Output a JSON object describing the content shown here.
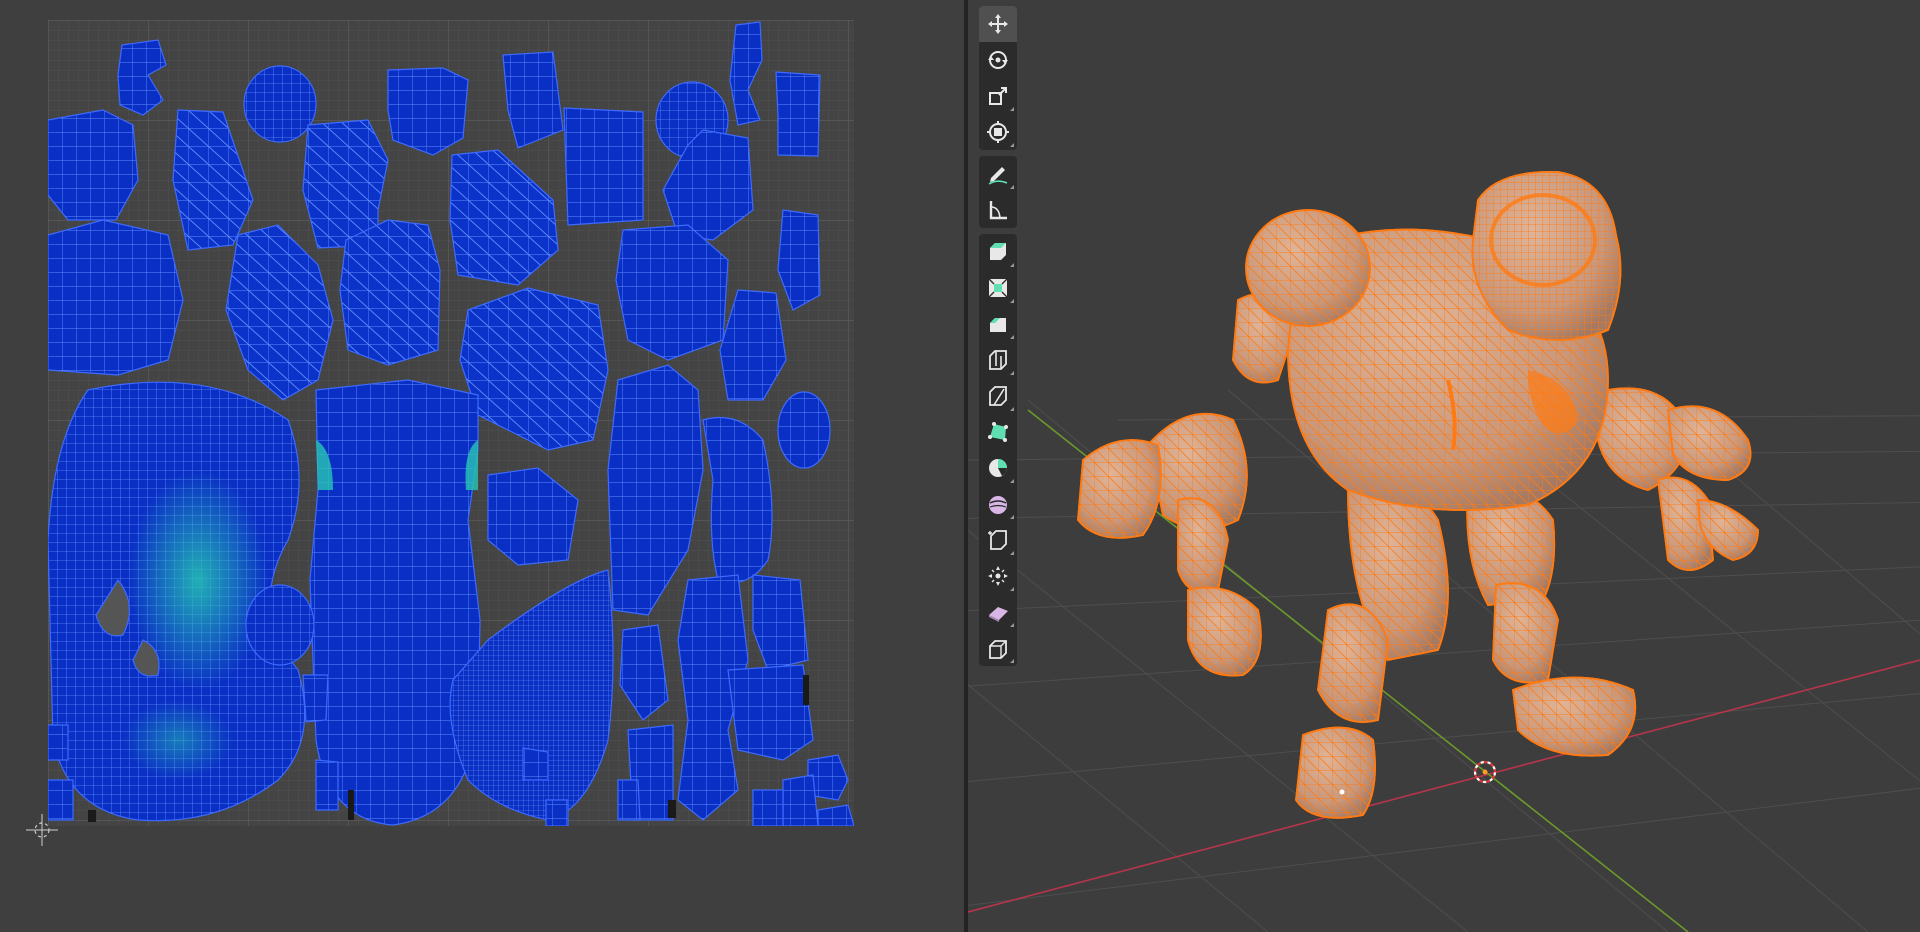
{
  "app": "Blender",
  "uv_editor": {
    "background_color": "#3f3f3f",
    "grid_color": "#5a5a5a",
    "island_fill_color": "#0a2fc4",
    "island_line_color": "#5f8bff",
    "stretch_color": "#27c6b4"
  },
  "viewport": {
    "background_color": "#3d3d3d",
    "mesh_color": "#c9977a",
    "edge_color": "#ff7a12",
    "x_axis_color": "#b9344a",
    "y_axis_color": "#6a9a2a",
    "grid_color": "#4e4e4e",
    "toolbar": [
      {
        "group": "transform",
        "tools": [
          {
            "id": "move",
            "icon": "move-icon"
          },
          {
            "id": "rotate",
            "icon": "rotate-icon"
          },
          {
            "id": "scale",
            "icon": "scale-icon"
          },
          {
            "id": "transform",
            "icon": "transform-icon"
          }
        ]
      },
      {
        "group": "annotate",
        "tools": [
          {
            "id": "annotate",
            "icon": "annotate-pencil-icon"
          },
          {
            "id": "measure",
            "icon": "measure-icon"
          }
        ]
      },
      {
        "group": "edit",
        "tools": [
          {
            "id": "extrude-region",
            "icon": "extrude-region-icon"
          },
          {
            "id": "inset-faces",
            "icon": "inset-faces-icon"
          },
          {
            "id": "bevel",
            "icon": "bevel-icon"
          },
          {
            "id": "loop-cut",
            "icon": "loop-cut-icon"
          },
          {
            "id": "knife",
            "icon": "knife-icon"
          },
          {
            "id": "poly-build",
            "icon": "poly-build-icon"
          },
          {
            "id": "spin",
            "icon": "spin-icon"
          },
          {
            "id": "smooth",
            "icon": "smooth-icon"
          },
          {
            "id": "edge-slide",
            "icon": "edge-slide-icon"
          },
          {
            "id": "shrink-fatten",
            "icon": "shrink-fatten-icon"
          },
          {
            "id": "shear",
            "icon": "shear-icon"
          },
          {
            "id": "rip-region",
            "icon": "rip-region-icon"
          }
        ]
      }
    ]
  }
}
